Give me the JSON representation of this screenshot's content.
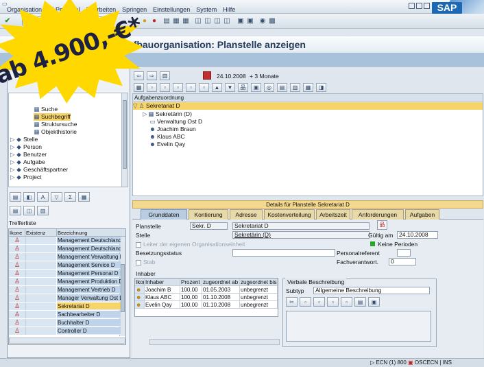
{
  "menubar": {
    "items": [
      "Organisation und Personal",
      "Bearbeiten",
      "Springen",
      "Einstellungen",
      "System",
      "Hilfe"
    ]
  },
  "brand": {
    "logo": "SAP",
    "accent": "#1c68b3"
  },
  "screen_title": "Aufbauorganisation: Planstelle anzeigen",
  "promo": {
    "text": "ab 4.900,-€*",
    "color": "#ffd800"
  },
  "left_tree": {
    "items": [
      {
        "label": "Suche",
        "type": "folder"
      },
      {
        "label": "Suchbegriff",
        "type": "search",
        "selected": true
      },
      {
        "label": "Struktursuche",
        "type": "search"
      },
      {
        "label": "Objekthistorie",
        "type": "search"
      },
      {
        "label": "Stelle",
        "type": "collapsed"
      },
      {
        "label": "Person",
        "type": "collapsed"
      },
      {
        "label": "Benutzer",
        "type": "collapsed"
      },
      {
        "label": "Aufgabe",
        "type": "collapsed"
      },
      {
        "label": "Geschäftspartner",
        "type": "collapsed"
      },
      {
        "label": "Project",
        "type": "collapsed"
      }
    ]
  },
  "hitlist": {
    "title": "Trefferliste",
    "columns": [
      "Ikone",
      "Existenz",
      "Bezeichnung"
    ],
    "rows": [
      "Management Deutschland",
      "Management Deutschland",
      "Management Verwaltung D",
      "Management Service D",
      "Management Personal D",
      "Management Produktion D",
      "Management Vertrieb D",
      "Manager Verwaltung Ost D",
      "Sekretariat D",
      "Sachbearbeiter D",
      "Buchhalter D",
      "Controller D"
    ],
    "selected_index": 8
  },
  "date_bar": {
    "date": "24.10.2008",
    "period": "+ 3 Monate"
  },
  "aufgaben": {
    "header": "Aufgabenzuordnung",
    "root": "Sekretariat D",
    "children": [
      "Sekretärin (D)",
      "Verwaltung Ost D",
      "Joachim Braun",
      "Klaus ABC",
      "Evelin Qay"
    ]
  },
  "detail": {
    "title": "Details für Planstelle Sekretariat D",
    "tabs": [
      "Grunddaten",
      "Kontierung",
      "Adresse",
      "Kostenverteilung",
      "Arbeitszeit",
      "Anforderungen",
      "Aufgaben"
    ],
    "planstelle_label": "Planstelle",
    "planstelle_code": "Sekr. D",
    "planstelle_name": "Sekretariat D",
    "stelle_label": "Stelle",
    "stelle_value": "Sekretärin (D)",
    "gueltig_label": "Gültig am",
    "gueltig_value": "24.10.2008",
    "leiter_label": "Leiter der eigenen Organisationseinheit",
    "perioden_label": "Keine Perioden",
    "besetzung_label": "Besetzungsstatus",
    "personalref_label": "Personalreferent",
    "stab_label": "Stab",
    "fachverant_label": "Fachverantwort.",
    "fachverant_value": "0",
    "inhaber_label": "Inhaber",
    "inhaber_columns": [
      "Ikone",
      "Inhaber",
      "Prozent",
      "zugeordnet ab",
      "zugeordnet bis"
    ],
    "inhaber_rows": [
      {
        "name": "Joachim B",
        "pct": "100,00",
        "ab": "01.05.2003",
        "bis": "unbegrenzt"
      },
      {
        "name": "Klaus ABC",
        "pct": "100,00",
        "ab": "01.10.2008",
        "bis": "unbegrenzt"
      },
      {
        "name": "Evelin Qay",
        "pct": "100,00",
        "ab": "01.10.2008",
        "bis": "unbegrenzt"
      }
    ],
    "verbal_label": "Verbale Beschreibung",
    "subtyp_label": "Subtyp",
    "subtyp_value": "Allgemeine Beschreibung"
  },
  "status": {
    "system": "ECN (1) 800",
    "server": "OSCECN",
    "mode": "INS"
  }
}
